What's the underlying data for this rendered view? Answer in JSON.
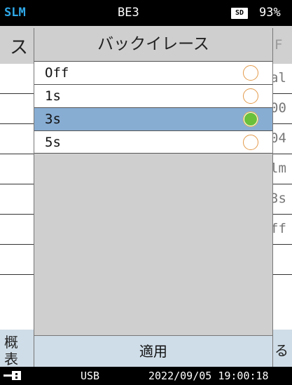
{
  "status": {
    "mode": "SLM",
    "file": "BE3",
    "sd_label": "SD",
    "battery": "93%"
  },
  "background": {
    "header_left": "ス",
    "header_right": "F",
    "row_values": [
      "al",
      "00",
      "04",
      "lm",
      "3s",
      "ff"
    ],
    "bottom_left_line1": "概",
    "bottom_left_line2": "表",
    "bottom_right": "る"
  },
  "dialog": {
    "title": "バックイレース",
    "options": [
      {
        "label": "Off",
        "selected": false
      },
      {
        "label": "1s",
        "selected": false
      },
      {
        "label": "3s",
        "selected": true
      },
      {
        "label": "5s",
        "selected": false
      }
    ],
    "apply_label": "適用"
  },
  "footer": {
    "usb": "USB",
    "datetime": "2022/09/05 19:00:18"
  },
  "colors": {
    "mode_accent": "#2fa8e8",
    "selected_row": "#88add3",
    "selected_radio": "#6ac03a",
    "radio_ring": "#e39a4a"
  }
}
